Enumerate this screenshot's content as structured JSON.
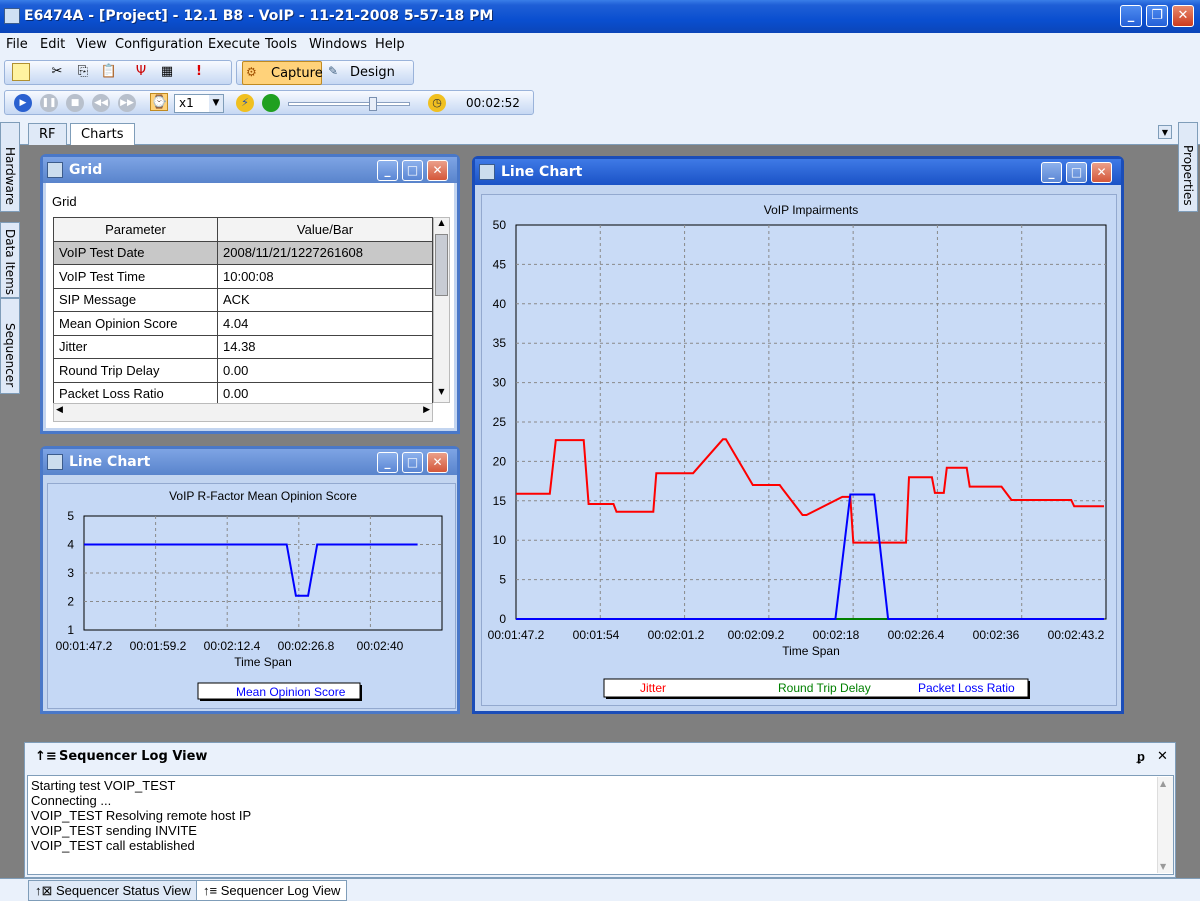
{
  "window": {
    "title": "E6474A - [Project] - 12.1 B8 - VoIP - 11-21-2008 5-57-18 PM",
    "minimize": "_",
    "restore": "❐",
    "close": "✕"
  },
  "menu": [
    "File",
    "Edit",
    "View",
    "Configuration",
    "Execute",
    "Tools",
    "Windows",
    "Help"
  ],
  "toolbar": {
    "capture_label": "Capture",
    "design_label": "Design",
    "speed_value": "x1",
    "timer_value": "00:02:52",
    "slider_level": 0.7
  },
  "tabs": {
    "rf": "RF",
    "charts": "Charts"
  },
  "side_tabs": {
    "hardware": "Hardware",
    "data_items": "Data Items",
    "sequencer": "Sequencer",
    "properties": "Properties"
  },
  "grid_panel": {
    "title": "Grid",
    "subtitle": "Grid",
    "columns": [
      "Parameter",
      "Value/Bar"
    ],
    "rows": [
      [
        "VoIP Test Date",
        "2008/11/21/1227261608"
      ],
      [
        "VoIP Test Time",
        "10:00:08"
      ],
      [
        "SIP Message",
        "ACK"
      ],
      [
        "Mean Opinion Score",
        "4.04"
      ],
      [
        "Jitter",
        "14.38"
      ],
      [
        "Round Trip Delay",
        "0.00"
      ],
      [
        "Packet Loss Ratio",
        "0.00"
      ]
    ]
  },
  "mos_panel": {
    "title": "Line Chart"
  },
  "impair_panel": {
    "title": "Line Chart"
  },
  "chart_data": [
    {
      "type": "line",
      "title": "VoIP R-Factor Mean Opinion Score",
      "xlabel": "Time Span",
      "ylabel": "",
      "ylim": [
        1,
        5
      ],
      "y_ticks": [
        "1",
        "2",
        "3",
        "4",
        "5"
      ],
      "x_ticks": [
        "00:01:47.2",
        "00:01:59.2",
        "00:02:12.4",
        "00:02:26.8",
        "00:02:40"
      ],
      "grid": true,
      "legend": "bottom",
      "series": [
        {
          "name": "Mean Opinion Score",
          "color": "#0000ff",
          "x": [
            107.2,
            116,
            124,
            132,
            140.5,
            142,
            144,
            145.5,
            150,
            156,
            162
          ],
          "y": [
            4,
            4,
            4,
            4,
            4,
            2.2,
            2.2,
            4,
            4,
            4,
            4
          ]
        }
      ],
      "xlim": [
        107.2,
        166
      ]
    },
    {
      "type": "line",
      "title": "VoIP Impairments",
      "xlabel": "Time Span",
      "ylabel": "",
      "ylim": [
        0,
        50
      ],
      "y_ticks": [
        "0",
        "5",
        "10",
        "15",
        "20",
        "25",
        "30",
        "35",
        "40",
        "45",
        "50"
      ],
      "x_ticks": [
        "00:01:47.2",
        "00:01:54",
        "00:02:01.2",
        "00:02:09.2",
        "00:02:18",
        "00:02:26.4",
        "00:02:36",
        "00:02:43.2"
      ],
      "grid": true,
      "legend": "bottom",
      "xlim": [
        107.2,
        166.5
      ],
      "series": [
        {
          "name": "Jitter",
          "color": "#ff0000",
          "x": [
            107.2,
            110.6,
            111.2,
            114,
            114.5,
            117,
            117.3,
            121,
            121.3,
            124.7,
            125,
            128,
            128.3,
            131,
            131.4,
            133.7,
            134,
            136,
            136.4,
            140,
            140.3,
            140.8,
            141.1,
            142,
            143,
            146.4,
            146.7,
            149,
            149.3,
            150.2,
            150.5,
            152.5,
            152.8,
            156,
            157,
            163,
            163.3,
            166.3
          ],
          "y": [
            15.9,
            15.9,
            22.7,
            22.7,
            14.6,
            14.6,
            13.6,
            13.6,
            18.5,
            18.5,
            18.5,
            22.8,
            22.8,
            17,
            17,
            17,
            16.5,
            13.2,
            13.2,
            15.5,
            15.5,
            15.5,
            9.7,
            9.7,
            9.7,
            9.7,
            18,
            18,
            16,
            16,
            19.2,
            19.2,
            16.8,
            16.8,
            15.1,
            15.1,
            14.3,
            14.3
          ]
        },
        {
          "name": "Round Trip Delay",
          "color": "#008000",
          "x": [
            107.2,
            166.3
          ],
          "y": [
            0,
            0
          ]
        },
        {
          "name": "Packet Loss Ratio",
          "color": "#0000ff",
          "x": [
            107.2,
            139.3,
            140.8,
            143.2,
            144.6,
            166.3
          ],
          "y": [
            0,
            0,
            15.8,
            15.8,
            0,
            0
          ]
        }
      ]
    }
  ],
  "sequencer": {
    "title": "Sequencer Log View",
    "pin": "ᵱ",
    "close": "✕",
    "log": [
      "Starting test VOIP_TEST",
      "Connecting ...",
      "VOIP_TEST Resolving remote host IP",
      "VOIP_TEST sending INVITE",
      "VOIP_TEST call established"
    ]
  },
  "status_tabs": [
    "Sequencer Status View",
    "Sequencer Log View"
  ]
}
